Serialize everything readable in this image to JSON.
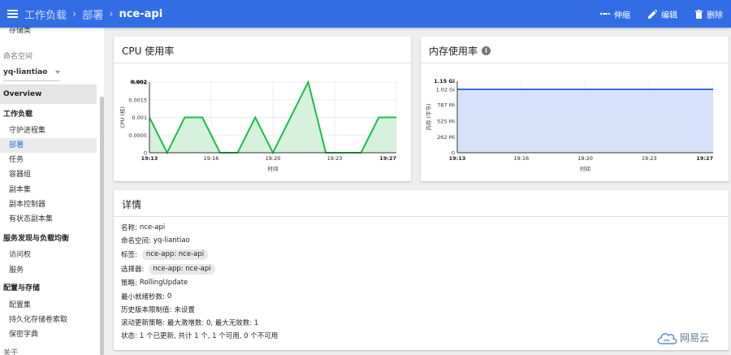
{
  "breadcrumb": {
    "items": [
      "工作负载",
      "部署"
    ],
    "current": "nce-api"
  },
  "toolbar": {
    "scale_label": "伸缩",
    "edit_label": "编辑",
    "delete_label": "删除"
  },
  "sidebar": {
    "top_item": "存储类",
    "namespace_label": "命名空间",
    "namespace_value": "yq-liantiao",
    "overview": "Overview",
    "workloads_header": "工作负载",
    "workloads": [
      "守护进程集",
      "部署",
      "任务",
      "容器组",
      "副本集",
      "副本控制器",
      "有状态副本集"
    ],
    "discovery_header": "服务发现与负载均衡",
    "discovery": [
      "访问权",
      "服务"
    ],
    "config_header": "配置与存储",
    "config": [
      "配置集",
      "持久化存储卷索取",
      "保密字典"
    ],
    "bottom_item": "关于"
  },
  "cpu_card": {
    "title": "CPU 使用率"
  },
  "mem_card": {
    "title": "内存使用率"
  },
  "chart_data": [
    {
      "type": "area",
      "ylabel": "CPU (核)",
      "xlabel": "时间",
      "ylim": [
        0,
        0.002
      ],
      "y_ticks": [
        "0",
        "0.0005",
        "0.001",
        "0.0015",
        "0.002"
      ],
      "y_max_label": "0.002",
      "x_ticks": [
        "19:13",
        "19:16",
        "19:20",
        "19:23",
        "19:27"
      ],
      "x": [
        "19:13",
        "19:14",
        "19:15",
        "19:16",
        "19:17",
        "19:18",
        "19:19",
        "19:20",
        "19:21",
        "19:22",
        "19:23",
        "19:24",
        "19:25",
        "19:26",
        "19:27"
      ],
      "values": [
        0.001,
        0,
        0.001,
        0.001,
        0,
        0,
        0.001,
        0,
        0.001,
        0.002,
        0,
        0,
        0,
        0.001,
        0.001
      ],
      "color": "#1dbd4d",
      "fill": "#d6f2dc"
    },
    {
      "type": "area",
      "ylabel": "内存 (字节)",
      "xlabel": "时间",
      "ylim": [
        0,
        1.15
      ],
      "y_unit": "Gi",
      "y_ticks": [
        "0",
        "262 Mi",
        "525 Mi",
        "787 Mi",
        "1.02 Gi"
      ],
      "y_max_label": "1.15 Gi",
      "x_ticks": [
        "19:13",
        "19:16",
        "19:20",
        "19:23",
        "19:27"
      ],
      "x": [
        "19:13",
        "19:27"
      ],
      "values": [
        1.02,
        1.02
      ],
      "color": "#326de6",
      "fill": "#d7e2f8"
    }
  ],
  "details": {
    "title": "详情",
    "name_key": "名称:",
    "name_val": "nce-api",
    "ns_key": "命名空间:",
    "ns_val": "yq-liantiao",
    "labels_key": "标签:",
    "labels_val": "nce-app: nce-api",
    "selector_key": "选择器:",
    "selector_val": "nce-app: nce-api",
    "strategy_key": "策略:",
    "strategy_val": "RollingUpdate",
    "min_ready_key": "最小就绪秒数:",
    "min_ready_val": "0",
    "revision_key": "历史版本限制值:",
    "revision_val": "未设置",
    "rolling_key": "滚动更新策略:",
    "rolling_val": "最大激增数: 0, 最大无效数: 1",
    "status_key": "状态:",
    "status_val": "1 个已更新, 共计 1 个, 1 个可用, 0 个不可用"
  },
  "watermark": "网易云"
}
